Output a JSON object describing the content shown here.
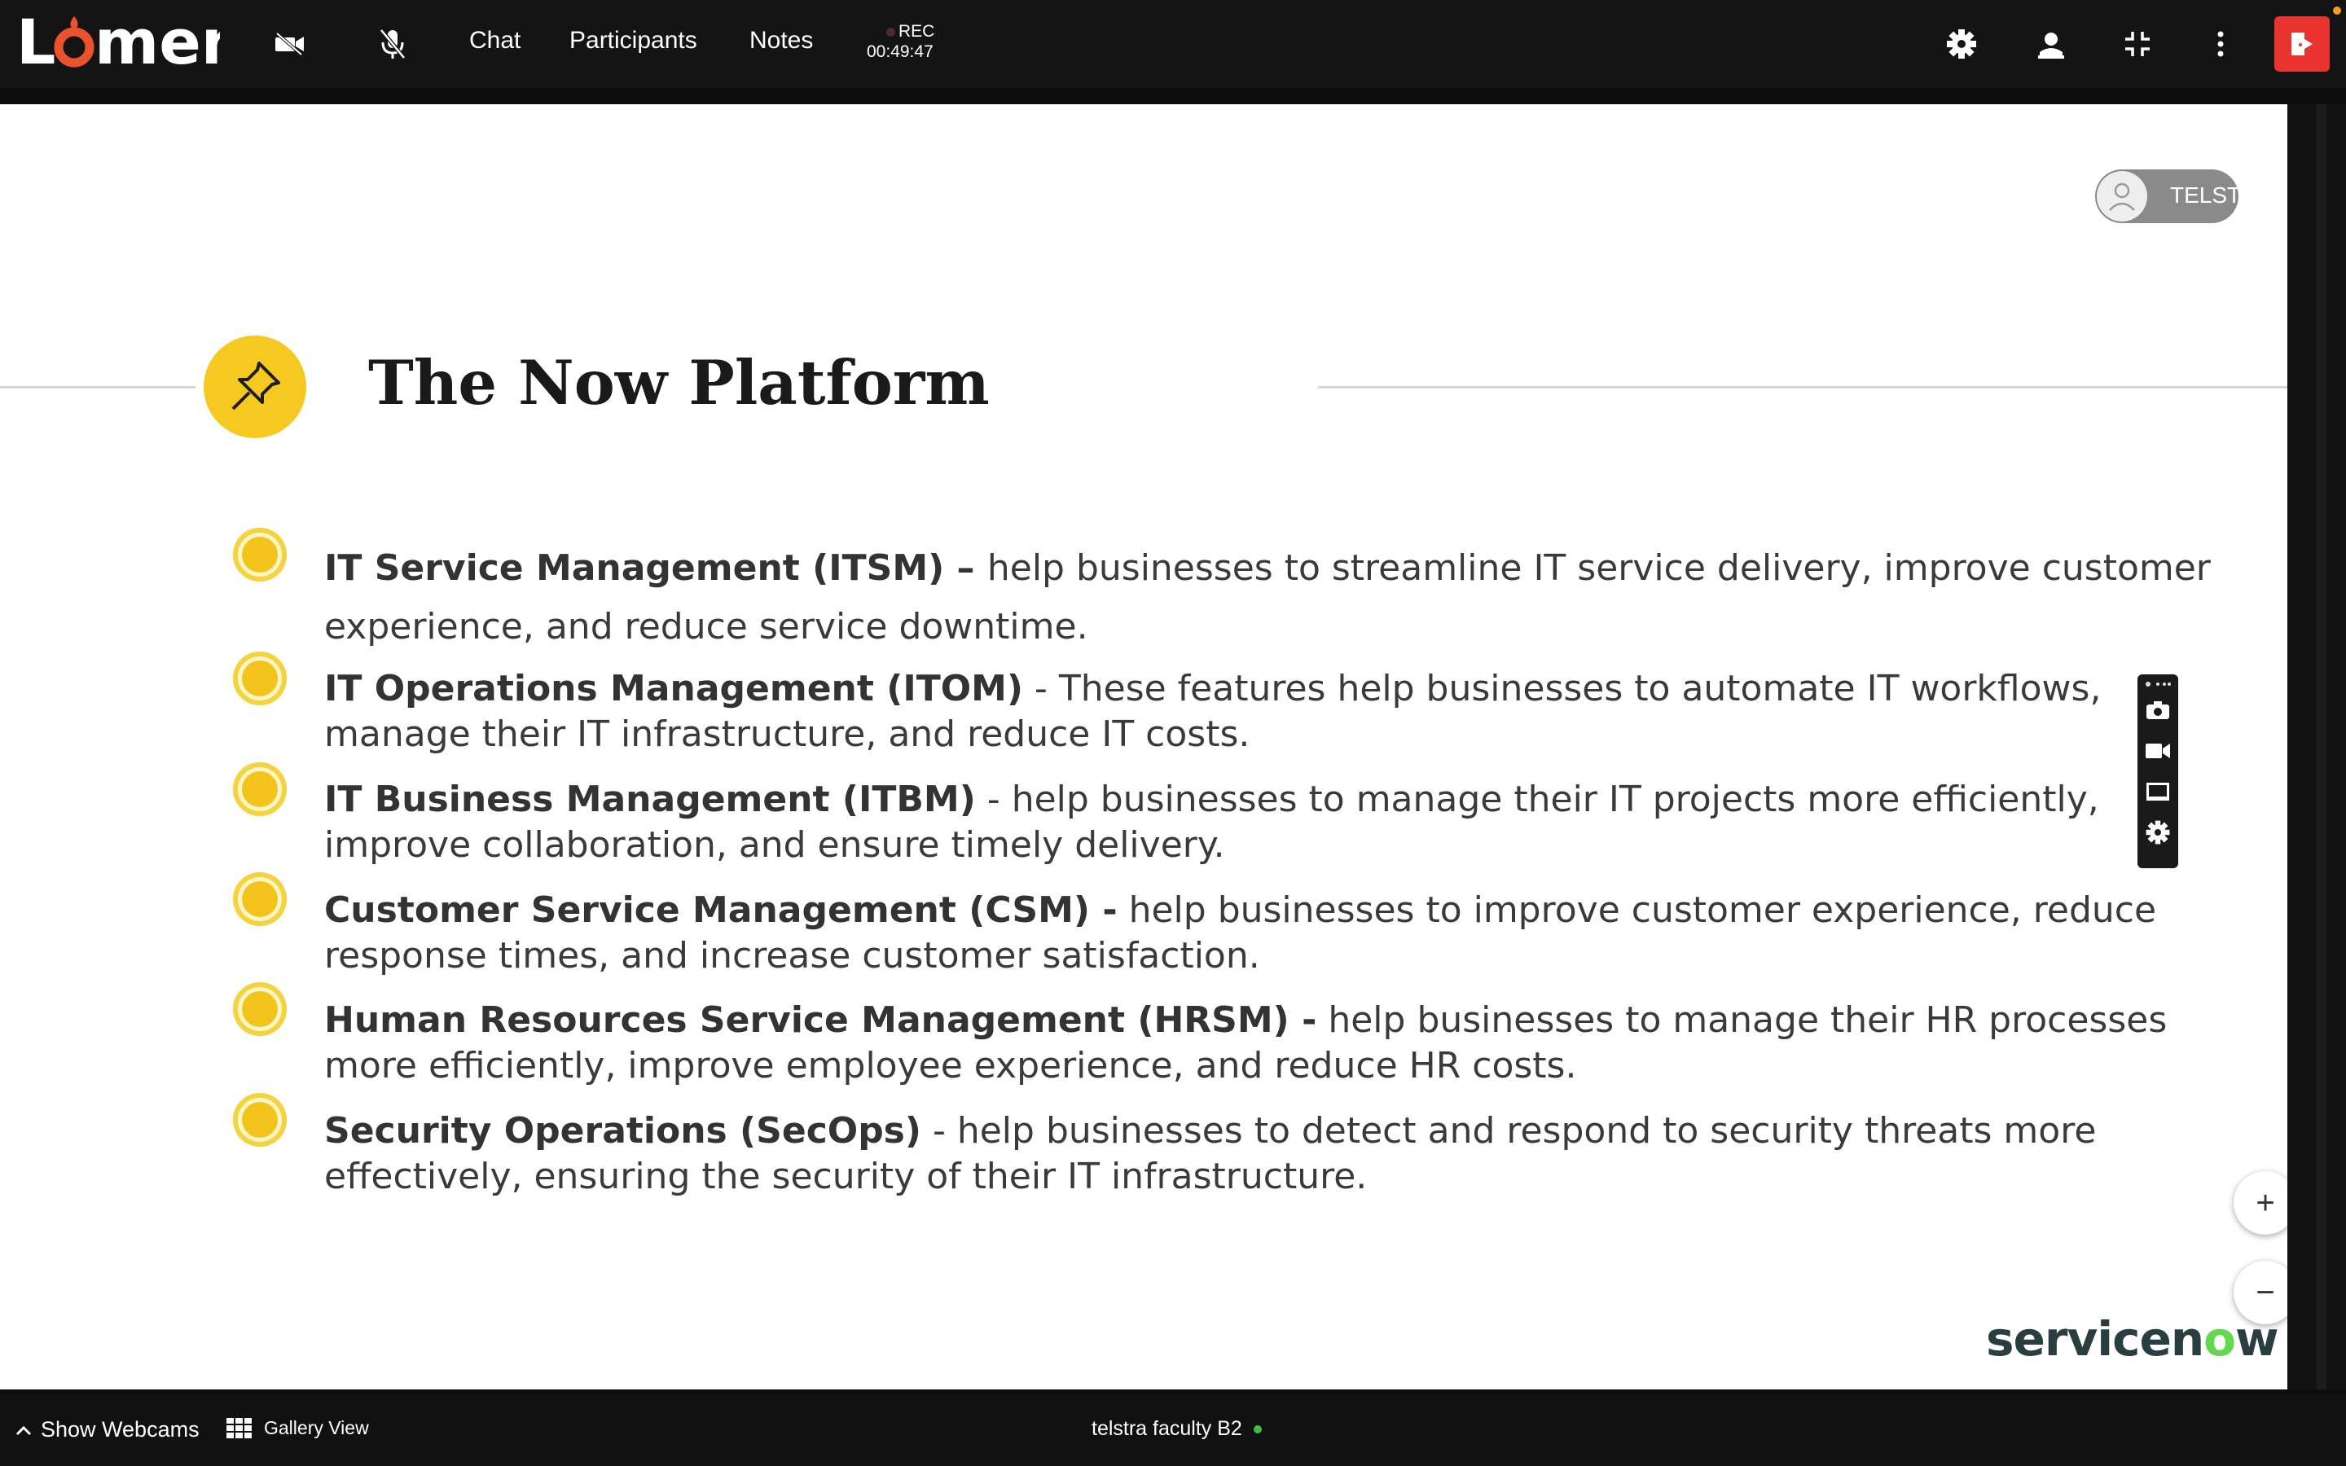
{
  "app": {
    "name": "Lumen"
  },
  "toolbar": {
    "chat_label": "Chat",
    "participants_label": "Participants",
    "notes_label": "Notes",
    "rec_label": "REC",
    "rec_time": "00:49:47",
    "icons": [
      "camera-off-icon",
      "mic-off-icon",
      "gear-icon",
      "hand-raise-icon",
      "minimize-icon",
      "more-icon",
      "exit-icon"
    ]
  },
  "presenter": {
    "name_truncated": "TELST"
  },
  "slide": {
    "title": "The Now Platform",
    "items": [
      {
        "name": "IT Service Management (ITSM)",
        "sep": " – ",
        "desc": "help businesses to streamline IT service delivery, improve customer experience, and reduce service downtime."
      },
      {
        "name": "IT Operations Management (ITOM)",
        "sep": " - ",
        "desc": "These features help businesses to automate IT workflows, manage their IT infrastructure, and reduce IT costs."
      },
      {
        "name": "IT Business Management (ITBM)",
        "sep": " - ",
        "desc": "help businesses to manage their IT projects more efficiently, improve collaboration, and ensure timely delivery."
      },
      {
        "name": "Customer Service Management (CSM) -",
        "sep": " ",
        "desc": "help businesses to improve customer experience, reduce response times, and increase customer satisfaction."
      },
      {
        "name": "Human Resources Service Management (HRSM) -",
        "sep": " ",
        "desc": "help businesses to manage their HR processes more efficiently, improve employee experience, and reduce HR costs."
      },
      {
        "name": "Security Operations (SecOps)",
        "sep": " - ",
        "desc": "help businesses to detect and respond to security threats more effectively, ensuring the security of their IT infrastructure."
      }
    ],
    "brand": "servicenow",
    "brand_parts": {
      "a": "servicen",
      "o": "o",
      "b": "w"
    }
  },
  "zoom": {
    "in_label": "+",
    "out_label": "−"
  },
  "bottom": {
    "webcams_label": "Show Webcams",
    "gallery_label": "Gallery View",
    "room_name": "telstra faculty B2"
  },
  "colors": {
    "accent_red": "#e8332e",
    "bullet_yellow": "#f2c41c",
    "servicenow_green": "#62d84e",
    "status_green": "#3fbf3f"
  }
}
